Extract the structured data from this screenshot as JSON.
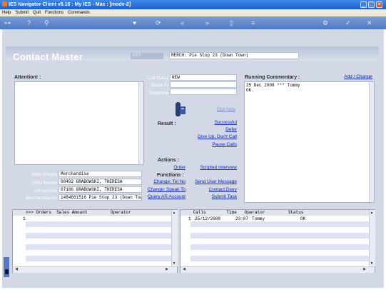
{
  "window": {
    "title": "IES Navigator Client v8.18 : My IES - Mac :     [mode-2]",
    "minimize": "_",
    "maximize": "□",
    "close": "✕"
  },
  "menu": [
    "Help",
    "Submit",
    "Quit",
    "Functions",
    "Commands"
  ],
  "form": {
    "title": "Contact Master",
    "key_label": "KEY",
    "key_value": "MERCH: Pie Stop 23 (Down Town)"
  },
  "attention": {
    "label": "Attention! :"
  },
  "center": {
    "call_status_label": "Call Status",
    "call_status_value": "NEW",
    "speak_to_label": "Speak To",
    "telephone_label": "Telephone",
    "dial_now": "Dial Now",
    "result_label": "Result :",
    "results": [
      "Successful",
      "Defer",
      "Give Up, Don't Call",
      "Pause Calls"
    ],
    "actions_label": "Actions :",
    "order_link": "Order",
    "scripted_interview_link": "Scripted Interview",
    "functions_label": "Functions :",
    "func_left": [
      "Change: Tel No",
      "Change: Speak To",
      "Query AR Account"
    ],
    "func_right": [
      "Send User Message",
      "Contact Diary",
      "Submit Task"
    ]
  },
  "commentary": {
    "label": "Running Commentary :",
    "add_change": "Add / Change",
    "text_line1": "25 Dec 2008 *** Tommy",
    "text_line2": "OK."
  },
  "details": {
    "store_label": "Store (Origin)",
    "store_value": "Merchandise",
    "crm_label": "CRM Record",
    "crm_value": "08492 GRABOWSKI, THERESA",
    "ar_label": "AR Account",
    "ar_value": "07186 GRABOWSKI, THERESA",
    "merch_label": "Merchandise No",
    "merch_value": "1484661516 Pie Stop 23 (Down Tow"
  },
  "orders_grid": {
    "header": ">>> Orders  Sales Amount         Operator",
    "row_number": "1"
  },
  "calls_grid": {
    "header": " Calls        Time   Operator         Status",
    "row_number": "1",
    "row": {
      "date": "25/12/2008",
      "time": "23:07",
      "operator": "Tommy",
      "status": "OK"
    }
  }
}
